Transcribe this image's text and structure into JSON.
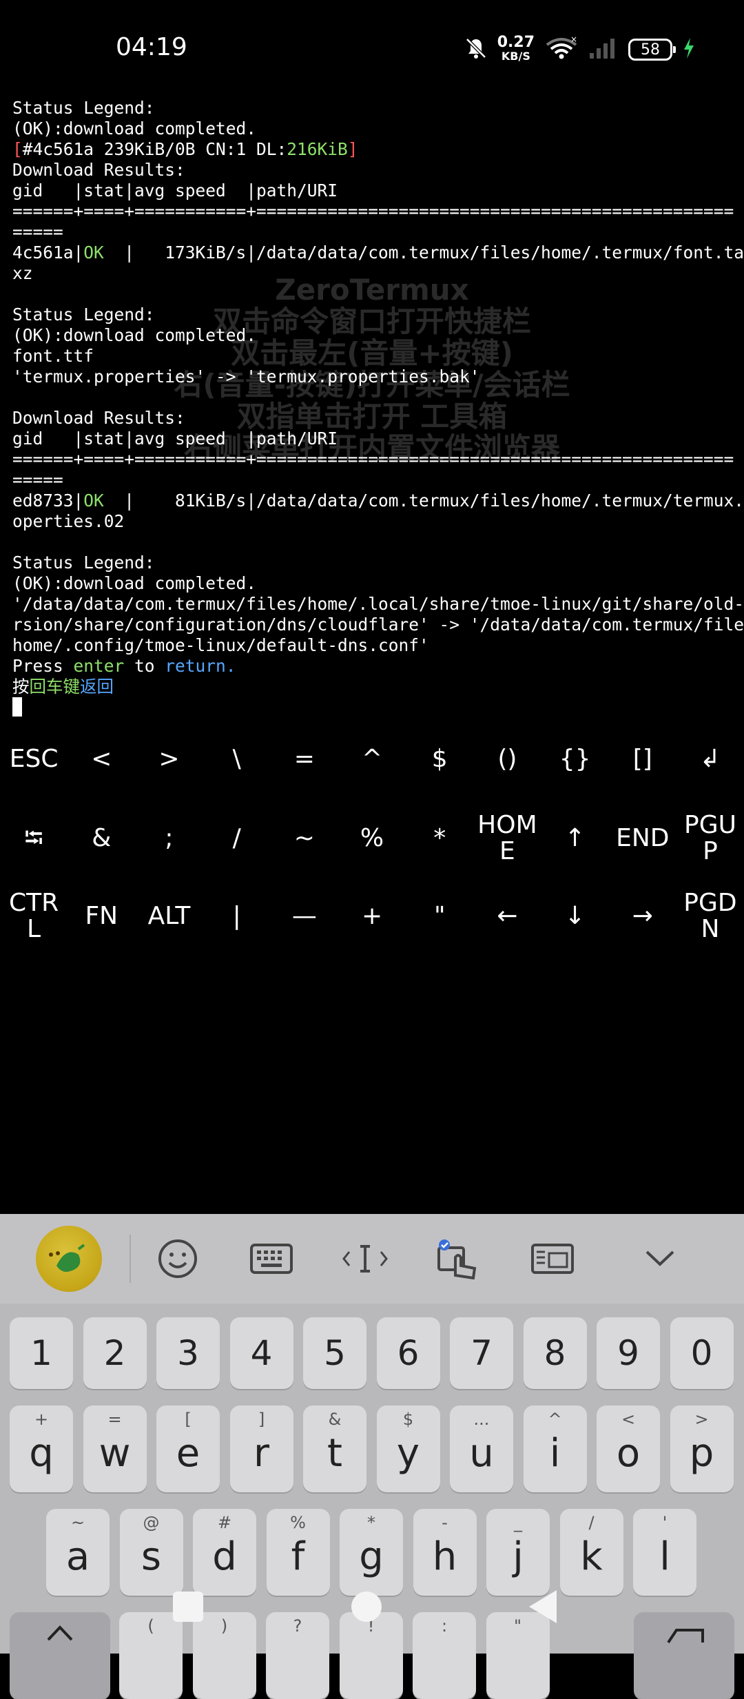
{
  "status_bar": {
    "time": "04:19",
    "net_speed_value": "0.27",
    "net_speed_unit": "KB/S",
    "battery": "58",
    "icons": [
      "mute-icon",
      "wifi-icon",
      "signal-icon",
      "charging-icon"
    ]
  },
  "terminal": {
    "lines": [
      {
        "segments": [
          {
            "t": "Status Legend:"
          }
        ]
      },
      {
        "segments": [
          {
            "t": "(OK):download completed."
          }
        ]
      },
      {
        "segments": [
          {
            "t": "[",
            "c": "red"
          },
          {
            "t": "#4c561a 239KiB/0B CN:1 DL:"
          },
          {
            "t": "216KiB",
            "c": "green"
          },
          {
            "t": "]",
            "c": "red"
          }
        ]
      },
      {
        "segments": [
          {
            "t": "Download Results:"
          }
        ]
      },
      {
        "segments": [
          {
            "t": "gid   |stat|avg speed  |path/URI"
          }
        ]
      },
      {
        "segments": [
          {
            "t": "======+====+===========+==============================================="
          }
        ]
      },
      {
        "segments": [
          {
            "t": "====="
          }
        ]
      },
      {
        "segments": [
          {
            "t": "4c561a|"
          },
          {
            "t": "OK",
            "c": "green"
          },
          {
            "t": "  |   173KiB/s|/data/data/com.termux/files/home/.termux/font.tar."
          }
        ]
      },
      {
        "segments": [
          {
            "t": "xz"
          }
        ]
      },
      {
        "segments": [
          {
            "t": ""
          }
        ]
      },
      {
        "segments": [
          {
            "t": "Status Legend:"
          }
        ]
      },
      {
        "segments": [
          {
            "t": "(OK):download completed."
          }
        ]
      },
      {
        "segments": [
          {
            "t": "font.ttf"
          }
        ]
      },
      {
        "segments": [
          {
            "t": "'termux.properties' -> 'termux.properties.bak'"
          }
        ]
      },
      {
        "segments": [
          {
            "t": ""
          }
        ]
      },
      {
        "segments": [
          {
            "t": "Download Results:"
          }
        ]
      },
      {
        "segments": [
          {
            "t": "gid   |stat|avg speed  |path/URI"
          }
        ]
      },
      {
        "segments": [
          {
            "t": "======+====+===========+==============================================="
          }
        ]
      },
      {
        "segments": [
          {
            "t": "====="
          }
        ]
      },
      {
        "segments": [
          {
            "t": "ed8733|"
          },
          {
            "t": "OK",
            "c": "green"
          },
          {
            "t": "  |    81KiB/s|/data/data/com.termux/files/home/.termux/termux.pr"
          }
        ]
      },
      {
        "segments": [
          {
            "t": "operties.02"
          }
        ]
      },
      {
        "segments": [
          {
            "t": ""
          }
        ]
      },
      {
        "segments": [
          {
            "t": "Status Legend:"
          }
        ]
      },
      {
        "segments": [
          {
            "t": "(OK):download completed."
          }
        ]
      },
      {
        "segments": [
          {
            "t": "'/data/data/com.termux/files/home/.local/share/tmoe-linux/git/share/old-ve"
          }
        ]
      },
      {
        "segments": [
          {
            "t": "rsion/share/configuration/dns/cloudflare' -> '/data/data/com.termux/files/"
          }
        ]
      },
      {
        "segments": [
          {
            "t": "home/.config/tmoe-linux/default-dns.conf'"
          }
        ]
      },
      {
        "segments": [
          {
            "t": "Press "
          },
          {
            "t": "enter",
            "c": "green"
          },
          {
            "t": " to "
          },
          {
            "t": "return.",
            "c": "blue"
          }
        ]
      },
      {
        "segments": [
          {
            "t": "按"
          },
          {
            "t": "回车键",
            "c": "green"
          },
          {
            "t": "返回",
            "c": "blue"
          }
        ]
      }
    ]
  },
  "watermark": [
    "ZeroTermux",
    "双击命令窗口打开快捷栏",
    "双击最左(音量+按键)",
    "右(音量-按键)打开菜单/会话栏",
    "双指单击打开 工具箱",
    "右侧菜单打开内置文件浏览器"
  ],
  "extra_keys": {
    "row1": [
      "ESC",
      "<",
      ">",
      "\\",
      "=",
      "^",
      "$",
      "()",
      "{}",
      "[]",
      "↲"
    ],
    "row2": [
      "⭾",
      "&",
      ";",
      "/",
      "~",
      "%",
      "*",
      "HOM\nE",
      "↑",
      "END",
      "PGU\nP"
    ],
    "row3": [
      "CTR\nL",
      "FN",
      "ALT",
      "|",
      "—",
      "+",
      "\"",
      "←",
      "↓",
      "→",
      "PGD\nN"
    ]
  },
  "keyboard": {
    "toolbar_icons": [
      "ime-logo-icon",
      "emoji-icon",
      "keyboard-icon",
      "cursor-edit-icon",
      "clipboard-icon",
      "handwriting-icon",
      "collapse-icon"
    ],
    "number_row": [
      "1",
      "2",
      "3",
      "4",
      "5",
      "6",
      "7",
      "8",
      "9",
      "0"
    ],
    "row_q": [
      {
        "sym": "+",
        "ltr": "q"
      },
      {
        "sym": "=",
        "ltr": "w"
      },
      {
        "sym": "[",
        "ltr": "e"
      },
      {
        "sym": "]",
        "ltr": "r"
      },
      {
        "sym": "&",
        "ltr": "t"
      },
      {
        "sym": "$",
        "ltr": "y"
      },
      {
        "sym": "...",
        "ltr": "u"
      },
      {
        "sym": "^",
        "ltr": "i"
      },
      {
        "sym": "<",
        "ltr": "o"
      },
      {
        "sym": ">",
        "ltr": "p"
      }
    ],
    "row_a": [
      {
        "sym": "~",
        "ltr": "a"
      },
      {
        "sym": "@",
        "ltr": "s"
      },
      {
        "sym": "#",
        "ltr": "d"
      },
      {
        "sym": "%",
        "ltr": "f"
      },
      {
        "sym": "*",
        "ltr": "g"
      },
      {
        "sym": "-",
        "ltr": "h"
      },
      {
        "sym": "_",
        "ltr": "j"
      },
      {
        "sym": "/",
        "ltr": "k"
      },
      {
        "sym": "'",
        "ltr": "l"
      }
    ],
    "row_z_syms": [
      "(",
      ")",
      "?",
      "!",
      ":",
      "\""
    ]
  }
}
